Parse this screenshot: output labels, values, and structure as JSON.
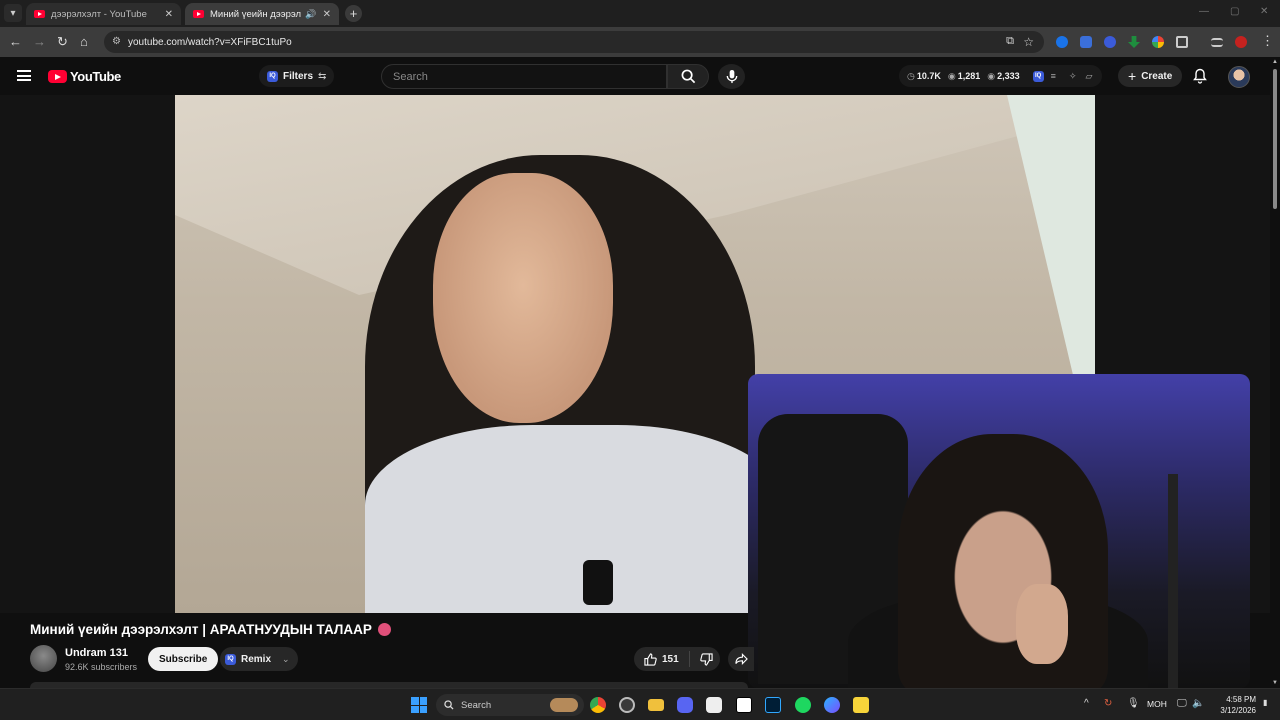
{
  "browser": {
    "tabs": [
      {
        "title": "дээрэлхэлт - YouTube",
        "active": false
      },
      {
        "title": "Миний үеийн дээрэлхэлт |",
        "active": true
      }
    ],
    "url": "youtube.com/watch?v=XFiFBC1tuPo"
  },
  "youtube": {
    "logo_text": "YouTube",
    "filters_label": "Filters",
    "search_placeholder": "Search",
    "stats": {
      "views": "10.7K",
      "likes": "1,281",
      "comments": "2,333"
    },
    "create_label": "Create"
  },
  "video": {
    "title": "Миний үеийн дээрэлхэлт | АРААТНУУДЫН ТАЛААР",
    "channel_name": "Undram 131",
    "subscribers": "92.6K subscribers",
    "subscribe_label": "Subscribe",
    "remix_label": "Remix",
    "like_count": "151"
  },
  "taskbar": {
    "search_label": "Search",
    "language": "МОН",
    "time": "4:58 PM",
    "date": "3/12/2026"
  },
  "colors": {
    "youtube_red": "#ff0033",
    "background": "#0f0f0f",
    "chip": "#272727"
  }
}
